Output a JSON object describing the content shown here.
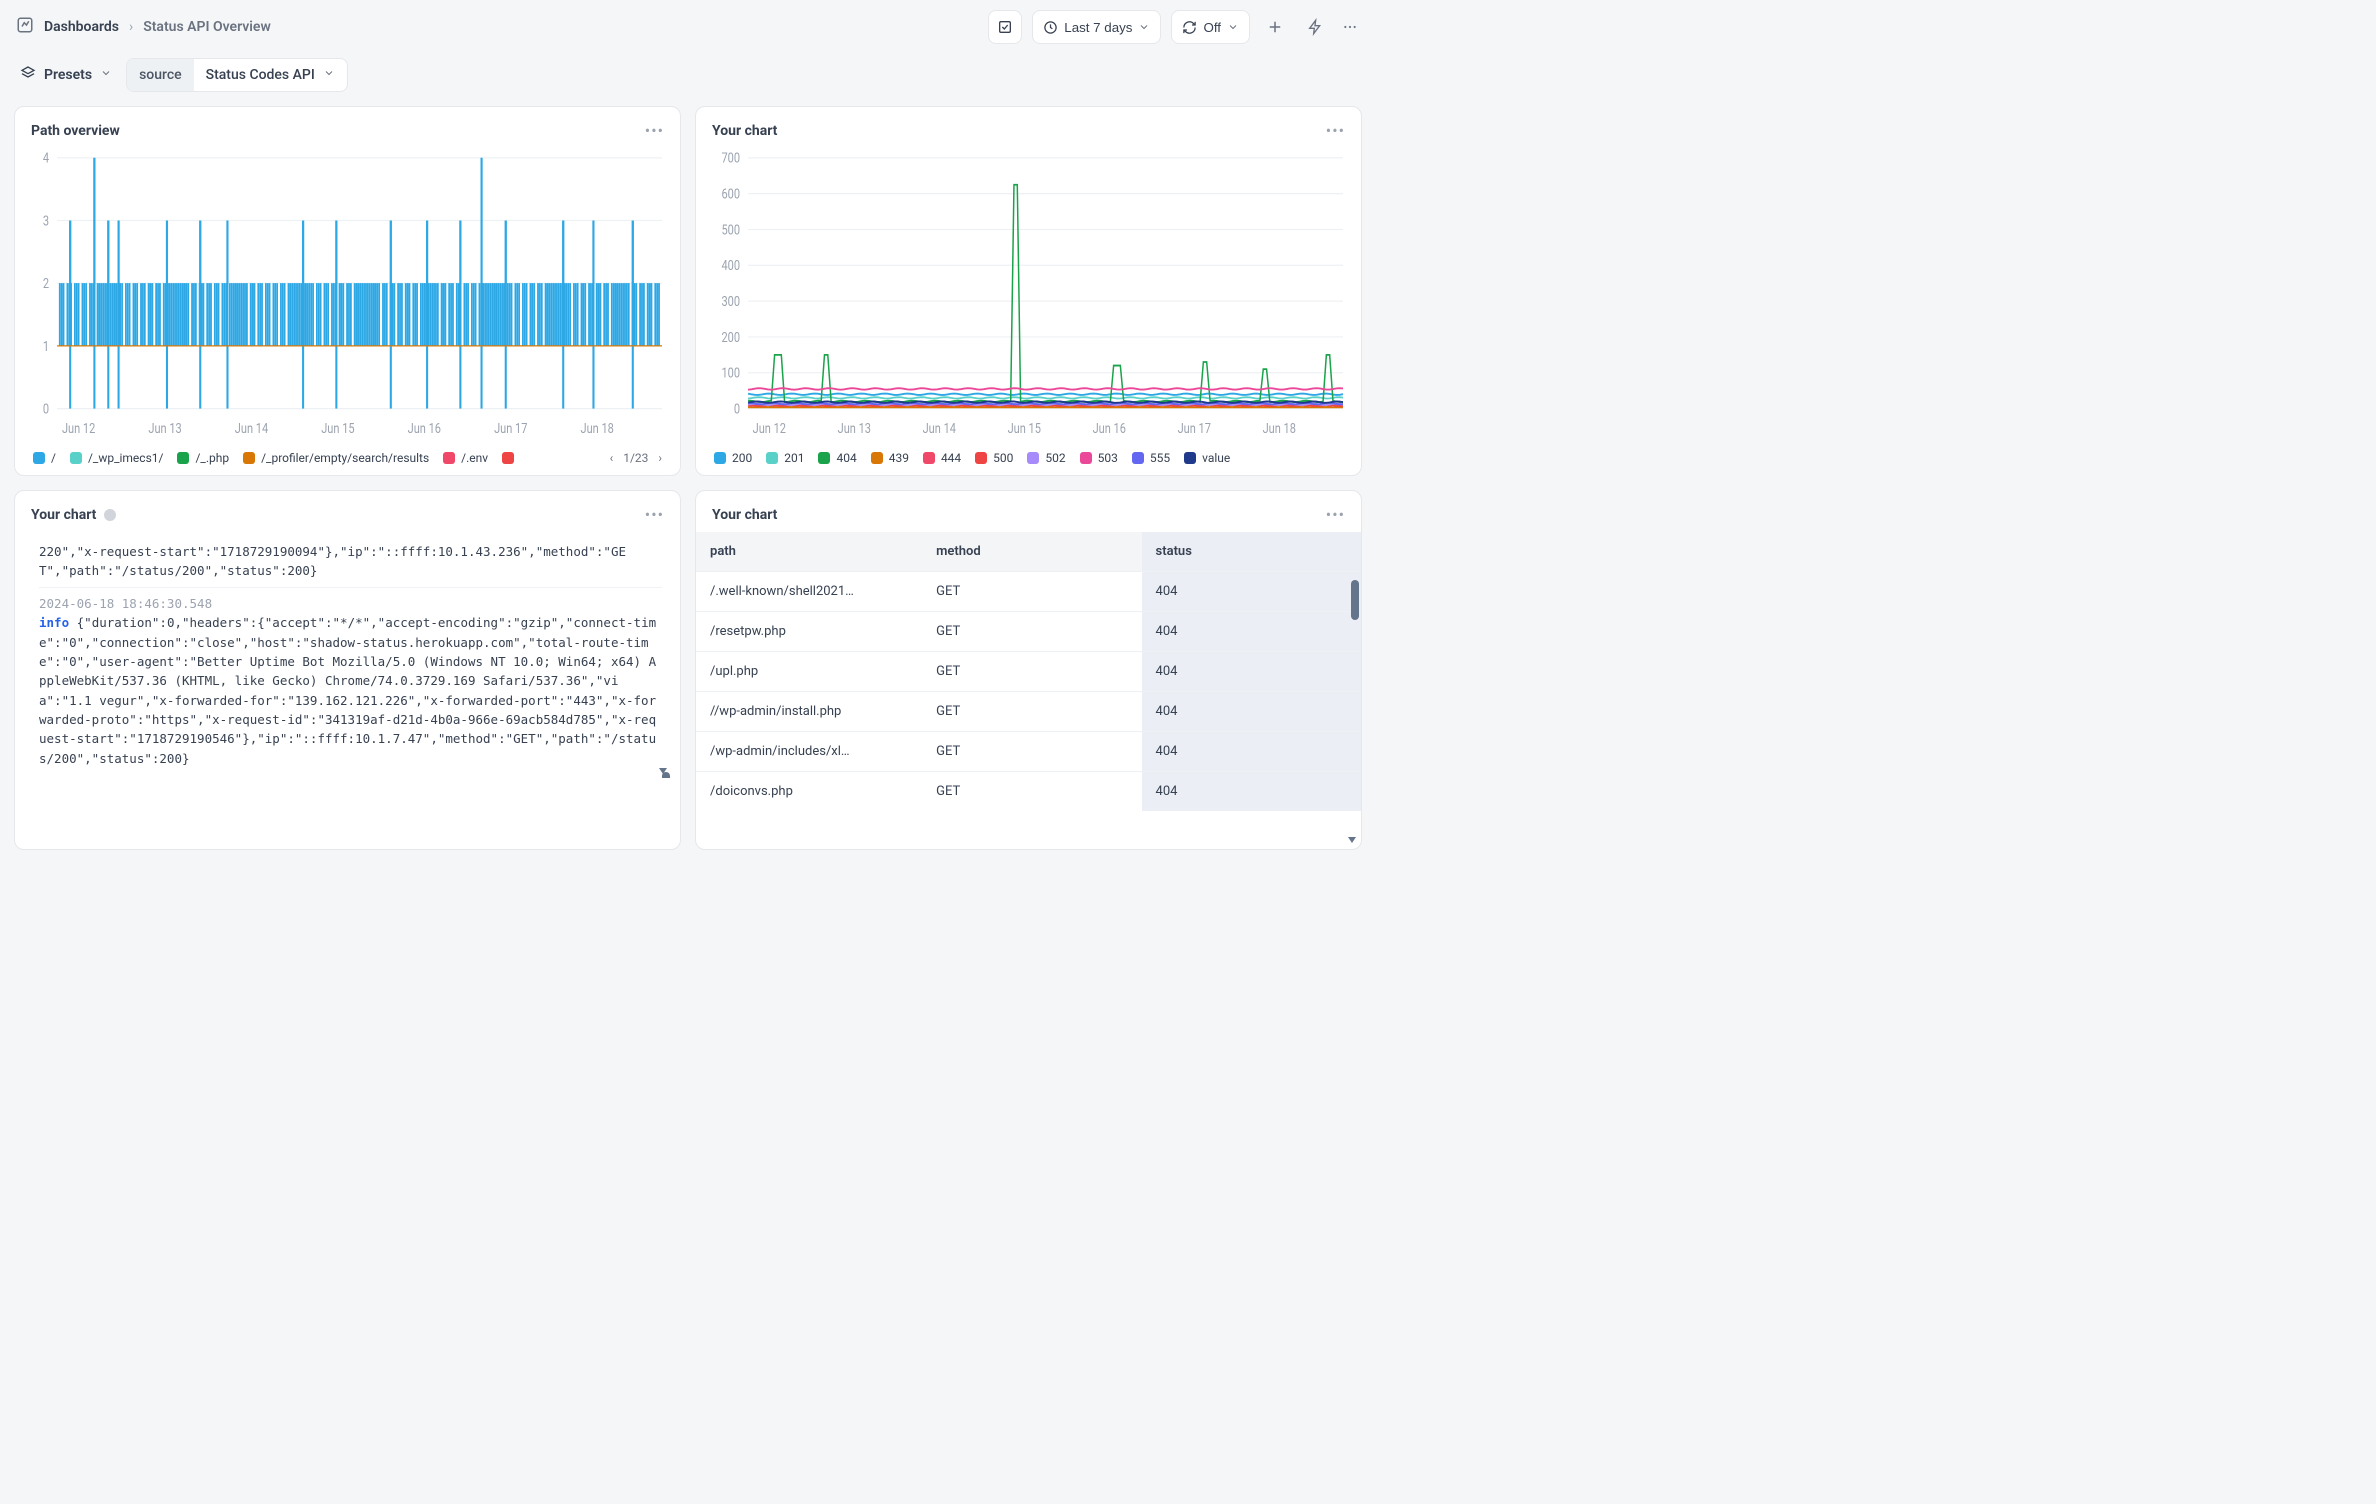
{
  "breadcrumb": {
    "root": "Dashboards",
    "current": "Status API Overview"
  },
  "toolbar": {
    "timerange": "Last 7 days",
    "refresh_mode": "Off"
  },
  "filter": {
    "presets_label": "Presets",
    "tag": "source",
    "value": "Status Codes API"
  },
  "cards": {
    "path_overview": {
      "title": "Path overview"
    },
    "your_chart_a": {
      "title": "Your chart"
    },
    "your_chart_b": {
      "title": "Your chart"
    },
    "your_chart_c": {
      "title": "Your chart"
    }
  },
  "legend_pager": {
    "text": "1/23"
  },
  "chart_data": [
    {
      "id": "path_overview",
      "type": "bar",
      "title": "Path overview",
      "xlabel": "",
      "ylabel": "",
      "ylim": [
        0,
        4
      ],
      "yticks": [
        0,
        1,
        2,
        3,
        4
      ],
      "categories": [
        "Jun 12",
        "Jun 13",
        "Jun 14",
        "Jun 15",
        "Jun 16",
        "Jun 17",
        "Jun 18"
      ],
      "note": "Many thin adjacent bars; most values oscillate between 1 and 2 with a handful of spikes to 3 or 4. values_pattern is a compact representation: for each value v the height repeats across the x range.",
      "spikes": [
        {
          "xfrac": 0.02,
          "v": 3
        },
        {
          "xfrac": 0.06,
          "v": 4
        },
        {
          "xfrac": 0.083,
          "v": 3
        },
        {
          "xfrac": 0.1,
          "v": 3
        },
        {
          "xfrac": 0.18,
          "v": 3
        },
        {
          "xfrac": 0.235,
          "v": 3
        },
        {
          "xfrac": 0.28,
          "v": 3
        },
        {
          "xfrac": 0.405,
          "v": 3
        },
        {
          "xfrac": 0.46,
          "v": 3
        },
        {
          "xfrac": 0.55,
          "v": 3
        },
        {
          "xfrac": 0.61,
          "v": 3
        },
        {
          "xfrac": 0.665,
          "v": 3
        },
        {
          "xfrac": 0.7,
          "v": 4
        },
        {
          "xfrac": 0.74,
          "v": 3
        },
        {
          "xfrac": 0.835,
          "v": 3
        },
        {
          "xfrac": 0.885,
          "v": 3
        },
        {
          "xfrac": 0.95,
          "v": 3
        }
      ],
      "legend": [
        {
          "label": "/",
          "color": "#2ea8e5"
        },
        {
          "label": "/_wp_imecs1/",
          "color": "#5ad1c8"
        },
        {
          "label": "/_.php",
          "color": "#1aa34a"
        },
        {
          "label": "/_profiler/empty/search/results",
          "color": "#d97706"
        },
        {
          "label": "/.env",
          "color": "#ef4869"
        },
        {
          "label": "",
          "color": "#ef4444"
        }
      ]
    },
    {
      "id": "status_lines",
      "type": "line",
      "title": "Your chart",
      "xlabel": "",
      "ylabel": "",
      "ylim": [
        0,
        700
      ],
      "yticks": [
        0,
        100,
        200,
        300,
        400,
        500,
        600,
        700
      ],
      "categories": [
        "Jun 12",
        "Jun 13",
        "Jun 14",
        "Jun 15",
        "Jun 16",
        "Jun 17",
        "Jun 18"
      ],
      "series": [
        {
          "name": "200",
          "color": "#2ea8e5",
          "baseline": 40,
          "spikes": []
        },
        {
          "name": "201",
          "color": "#5ad1c8",
          "baseline": 30,
          "spikes": []
        },
        {
          "name": "404",
          "color": "#1aa34a",
          "baseline": 20,
          "spikes": [
            {
              "xfrac": 0.05,
              "v": 150
            },
            {
              "xfrac": 0.13,
              "v": 150
            },
            {
              "xfrac": 0.45,
              "v": 625
            },
            {
              "xfrac": 0.62,
              "v": 120
            },
            {
              "xfrac": 0.77,
              "v": 130
            },
            {
              "xfrac": 0.87,
              "v": 110
            },
            {
              "xfrac": 0.975,
              "v": 150
            }
          ]
        },
        {
          "name": "439",
          "color": "#d97706",
          "baseline": 6,
          "spikes": []
        },
        {
          "name": "444",
          "color": "#ef4869",
          "baseline": 10,
          "spikes": []
        },
        {
          "name": "500",
          "color": "#ef4444",
          "baseline": 8,
          "spikes": []
        },
        {
          "name": "502",
          "color": "#a78bfa",
          "baseline": 12,
          "spikes": []
        },
        {
          "name": "503",
          "color": "#ec4899",
          "baseline": 55,
          "spikes": []
        },
        {
          "name": "555",
          "color": "#6366f1",
          "baseline": 14,
          "spikes": []
        },
        {
          "name": "value",
          "color": "#1f3a8a",
          "baseline": 18,
          "spikes": []
        }
      ]
    }
  ],
  "logs": {
    "entries": [
      {
        "partial_lead": "220\",\"x-request-start\":\"1718729190094\"},\"ip\":\"::ffff:10.1.43.236\",\"method\":\"GET\",\"path\":\"/status/200\",\"status\":200}"
      },
      {
        "ts": "2024-06-18 18:46:30.548",
        "level": "info",
        "json": "{\"duration\":0,\"headers\":{\"accept\":\"*/*\",\"accept-encoding\":\"gzip\",\"connect-time\":\"0\",\"connection\":\"close\",\"host\":\"shadow-status.herokuapp.com\",\"total-route-time\":\"0\",\"user-agent\":\"Better Uptime Bot Mozilla/5.0 (Windows NT 10.0; Win64; x64) AppleWebKit/537.36 (KHTML, like Gecko) Chrome/74.0.3729.169 Safari/537.36\",\"via\":\"1.1 vegur\",\"x-forwarded-for\":\"139.162.121.226\",\"x-forwarded-port\":\"443\",\"x-forwarded-proto\":\"https\",\"x-request-id\":\"341319af-d21d-4b0a-966e-69acb584d785\",\"x-request-start\":\"1718729190546\"},\"ip\":\"::ffff:10.1.7.47\",\"method\":\"GET\",\"path\":\"/status/200\",\"status\":200}"
      }
    ]
  },
  "path_table": {
    "columns": {
      "path": "path",
      "method": "method",
      "status": "status"
    },
    "rows": [
      {
        "path": "/.well-known/shell2021…",
        "method": "GET",
        "status": "404"
      },
      {
        "path": "/resetpw.php",
        "method": "GET",
        "status": "404"
      },
      {
        "path": "/upl.php",
        "method": "GET",
        "status": "404"
      },
      {
        "path": "//wp-admin/install.php",
        "method": "GET",
        "status": "404"
      },
      {
        "path": "/wp-admin/includes/xl…",
        "method": "GET",
        "status": "404"
      },
      {
        "path": "/doiconvs.php",
        "method": "GET",
        "status": "404"
      }
    ]
  }
}
